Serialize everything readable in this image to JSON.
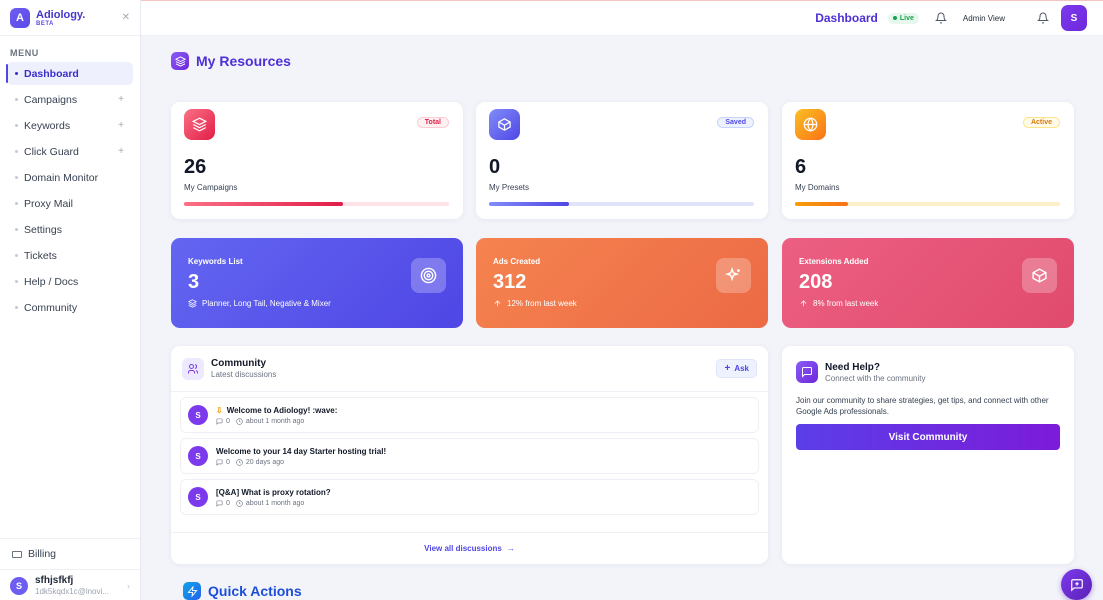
{
  "brand": {
    "logo_letter": "A",
    "name": "Adiology.",
    "badge": "BETA"
  },
  "sidebar": {
    "menu_label": "MENU",
    "items": [
      {
        "label": "Dashboard",
        "active": true,
        "expandable": false
      },
      {
        "label": "Campaigns",
        "active": false,
        "expandable": true
      },
      {
        "label": "Keywords",
        "active": false,
        "expandable": true
      },
      {
        "label": "Click Guard",
        "active": false,
        "expandable": true
      },
      {
        "label": "Domain Monitor",
        "active": false,
        "expandable": false
      },
      {
        "label": "Proxy Mail",
        "active": false,
        "expandable": false
      },
      {
        "label": "Settings",
        "active": false,
        "expandable": false
      },
      {
        "label": "Tickets",
        "active": false,
        "expandable": false
      },
      {
        "label": "Help / Docs",
        "active": false,
        "expandable": false
      },
      {
        "label": "Community",
        "active": false,
        "expandable": false
      }
    ],
    "billing_label": "Billing",
    "user": {
      "initial": "S",
      "name": "sfhjsfkfj",
      "email": "1dk5kqdx1c@lnovi..."
    }
  },
  "header": {
    "title": "Dashboard",
    "live_label": "Live",
    "admin_label": "Admin View",
    "avatar_initial": "S"
  },
  "resources": {
    "title": "My Resources",
    "cards": [
      {
        "tag": "Total",
        "value": "26",
        "label": "My Campaigns",
        "progress": 0.6,
        "icon": "layers-icon"
      },
      {
        "tag": "Saved",
        "value": "0",
        "label": "My Presets",
        "progress": 0.3,
        "icon": "box-icon"
      },
      {
        "tag": "Active",
        "value": "6",
        "label": "My Domains",
        "progress": 0.2,
        "icon": "globe-icon"
      }
    ]
  },
  "stats": [
    {
      "label": "Keywords List",
      "value": "3",
      "sub": "Planner, Long Tail, Negative & Mixer",
      "icon": "target-icon"
    },
    {
      "label": "Ads Created",
      "value": "312",
      "sub": "12% from last week",
      "icon": "sparkles-icon"
    },
    {
      "label": "Extensions Added",
      "value": "208",
      "sub": "8% from last week",
      "icon": "box-icon"
    }
  ],
  "community": {
    "title": "Community",
    "subtitle": "Latest discussions",
    "ask_label": "Ask",
    "discussions": [
      {
        "initial": "S",
        "title": "Welcome to Adiology! :wave:",
        "pinned": true,
        "replies": "0",
        "time": "about 1 month ago"
      },
      {
        "initial": "S",
        "title": "Welcome to your 14 day Starter hosting trial!",
        "pinned": false,
        "replies": "0",
        "time": "20 days ago"
      },
      {
        "initial": "S",
        "title": "[Q&A] What is proxy rotation?",
        "pinned": false,
        "replies": "0",
        "time": "about 1 month ago"
      }
    ],
    "view_all": "View all discussions"
  },
  "help": {
    "title": "Need Help?",
    "subtitle": "Connect with the community",
    "text": "Join our community to share strategies, get tips, and connect with other Google Ads professionals.",
    "button": "Visit Community"
  },
  "quick_actions": {
    "title": "Quick Actions"
  },
  "colors": {
    "accent": "#4f2fd6",
    "campaigns": "#f43f5e",
    "presets": "#6366f1",
    "domains": "#f59e0b",
    "keywords_card": "#5b50e6",
    "ads_card": "#f0764a",
    "extensions_card": "#e45476"
  }
}
